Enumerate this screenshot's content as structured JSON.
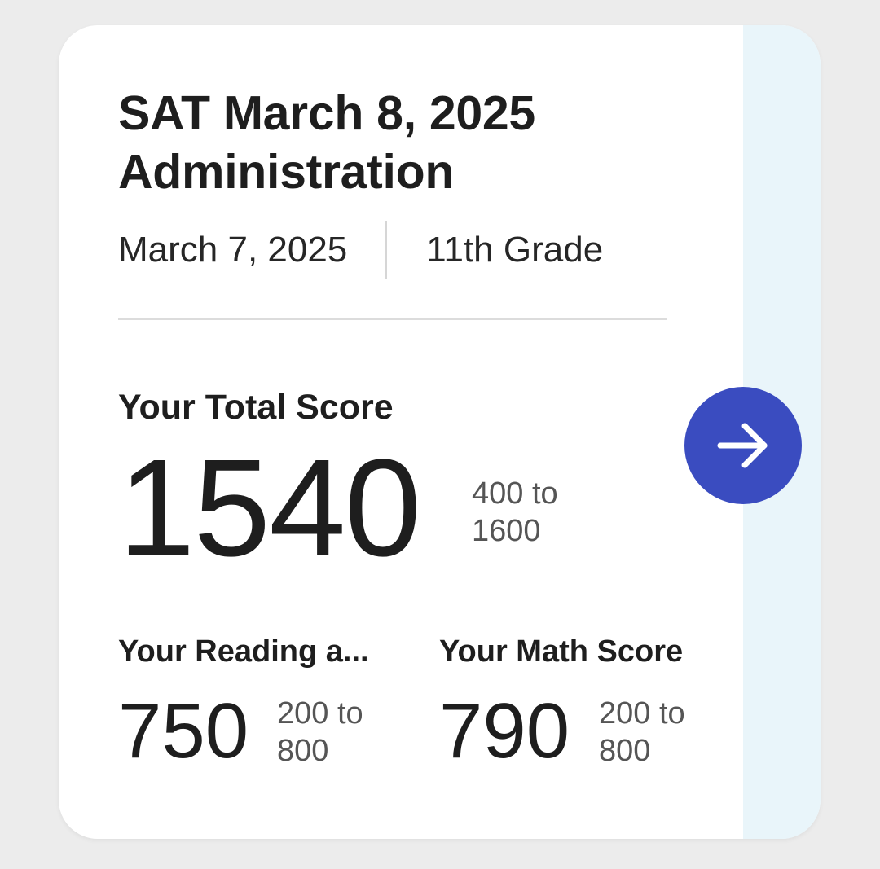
{
  "test": {
    "title": "SAT March 8, 2025 Administration",
    "date": "March 7, 2025",
    "grade": "11th Grade"
  },
  "total": {
    "label": "Your Total Score",
    "value": "1540",
    "range": "400 to 1600"
  },
  "reading": {
    "label": "Your Reading a...",
    "value": "750",
    "range": "200 to 800"
  },
  "math": {
    "label": "Your Math Score",
    "value": "790",
    "range": "200 to 800"
  },
  "icons": {
    "details": "arrow-right-icon"
  },
  "colors": {
    "accent": "#3a4cc0",
    "side_panel": "#e9f5fa",
    "background": "#ececec"
  }
}
